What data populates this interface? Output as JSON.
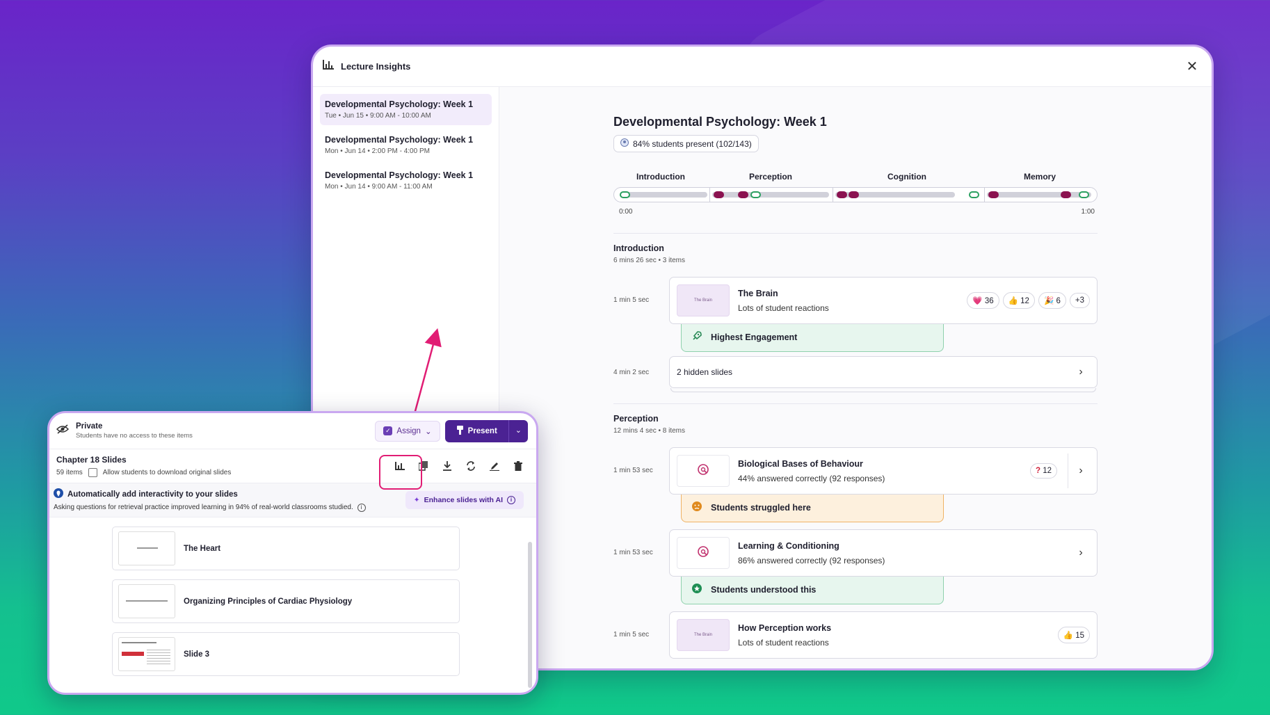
{
  "window": {
    "title": "Lecture Insights"
  },
  "sidebar": {
    "items": [
      {
        "title": "Developmental Psychology: Week 1",
        "date": "Tue • Jun 15 • 9:00 AM - 10:00 AM"
      },
      {
        "title": "Developmental Psychology: Week 1",
        "date": "Mon • Jun 14 • 2:00 PM - 4:00 PM"
      },
      {
        "title": "Developmental Psychology: Week 1",
        "date": "Mon • Jun 14 • 9:00 AM - 11:00 AM"
      }
    ]
  },
  "main": {
    "title": "Developmental Psychology: Week 1",
    "attendance": "84% students present (102/143)",
    "timeline": {
      "sections": [
        "Introduction",
        "Perception",
        "Cognition",
        "Memory"
      ],
      "start": "0:00",
      "end": "1:00"
    },
    "sections": [
      {
        "name": "Introduction",
        "meta": "6 mins 26 sec  •  3 items",
        "rows": [
          {
            "duration": "1 min 5 sec",
            "title": "The Brain",
            "subtitle": "Lots of student reactions",
            "thumb_text": "The Brain",
            "reactions": [
              "💗 36",
              "👍 12",
              "🎉 6",
              "+3"
            ],
            "banner": "Highest Engagement"
          },
          {
            "duration": "4 min 2 sec",
            "title": "2 hidden slides"
          }
        ]
      },
      {
        "name": "Perception",
        "meta": "12 mins 4 sec  •  8 items",
        "rows": [
          {
            "duration": "1 min 53 sec",
            "title": "Biological Bases of Behaviour",
            "subtitle": "44% answered correctly (92 responses)",
            "badge": "12",
            "banner": "Students struggled here"
          },
          {
            "duration": "1 min 53 sec",
            "title": "Learning & Conditioning",
            "subtitle": "86% answered correctly (92 responses)",
            "banner": "Students understood this"
          },
          {
            "duration": "1 min 5 sec",
            "title": "How Perception works",
            "subtitle": "Lots of student reactions",
            "thumb_text": "The Brain",
            "reactions": [
              "👍 15"
            ]
          }
        ]
      }
    ]
  },
  "panel": {
    "privacy_title": "Private",
    "privacy_sub": "Students have no access to these items",
    "assign_label": "Assign",
    "present_label": "Present",
    "deck_title": "Chapter 18 Slides",
    "item_count": "59 items",
    "download_label": "Allow students to download original slides",
    "ai_title": "Automatically add interactivity to your slides",
    "ai_sub": "Asking questions for retrieval practice improved learning in 94% of real-world classrooms studied.",
    "enhance_label": "Enhance slides with AI",
    "slides": [
      "The Heart",
      "Organizing Principles of Cardiac Physiology",
      "Slide 3"
    ]
  },
  "colors": {
    "accent": "#4b2293",
    "highlight": "#e11d74",
    "wrong_dot": "#8b1250",
    "right_dot": "#2aa060"
  }
}
